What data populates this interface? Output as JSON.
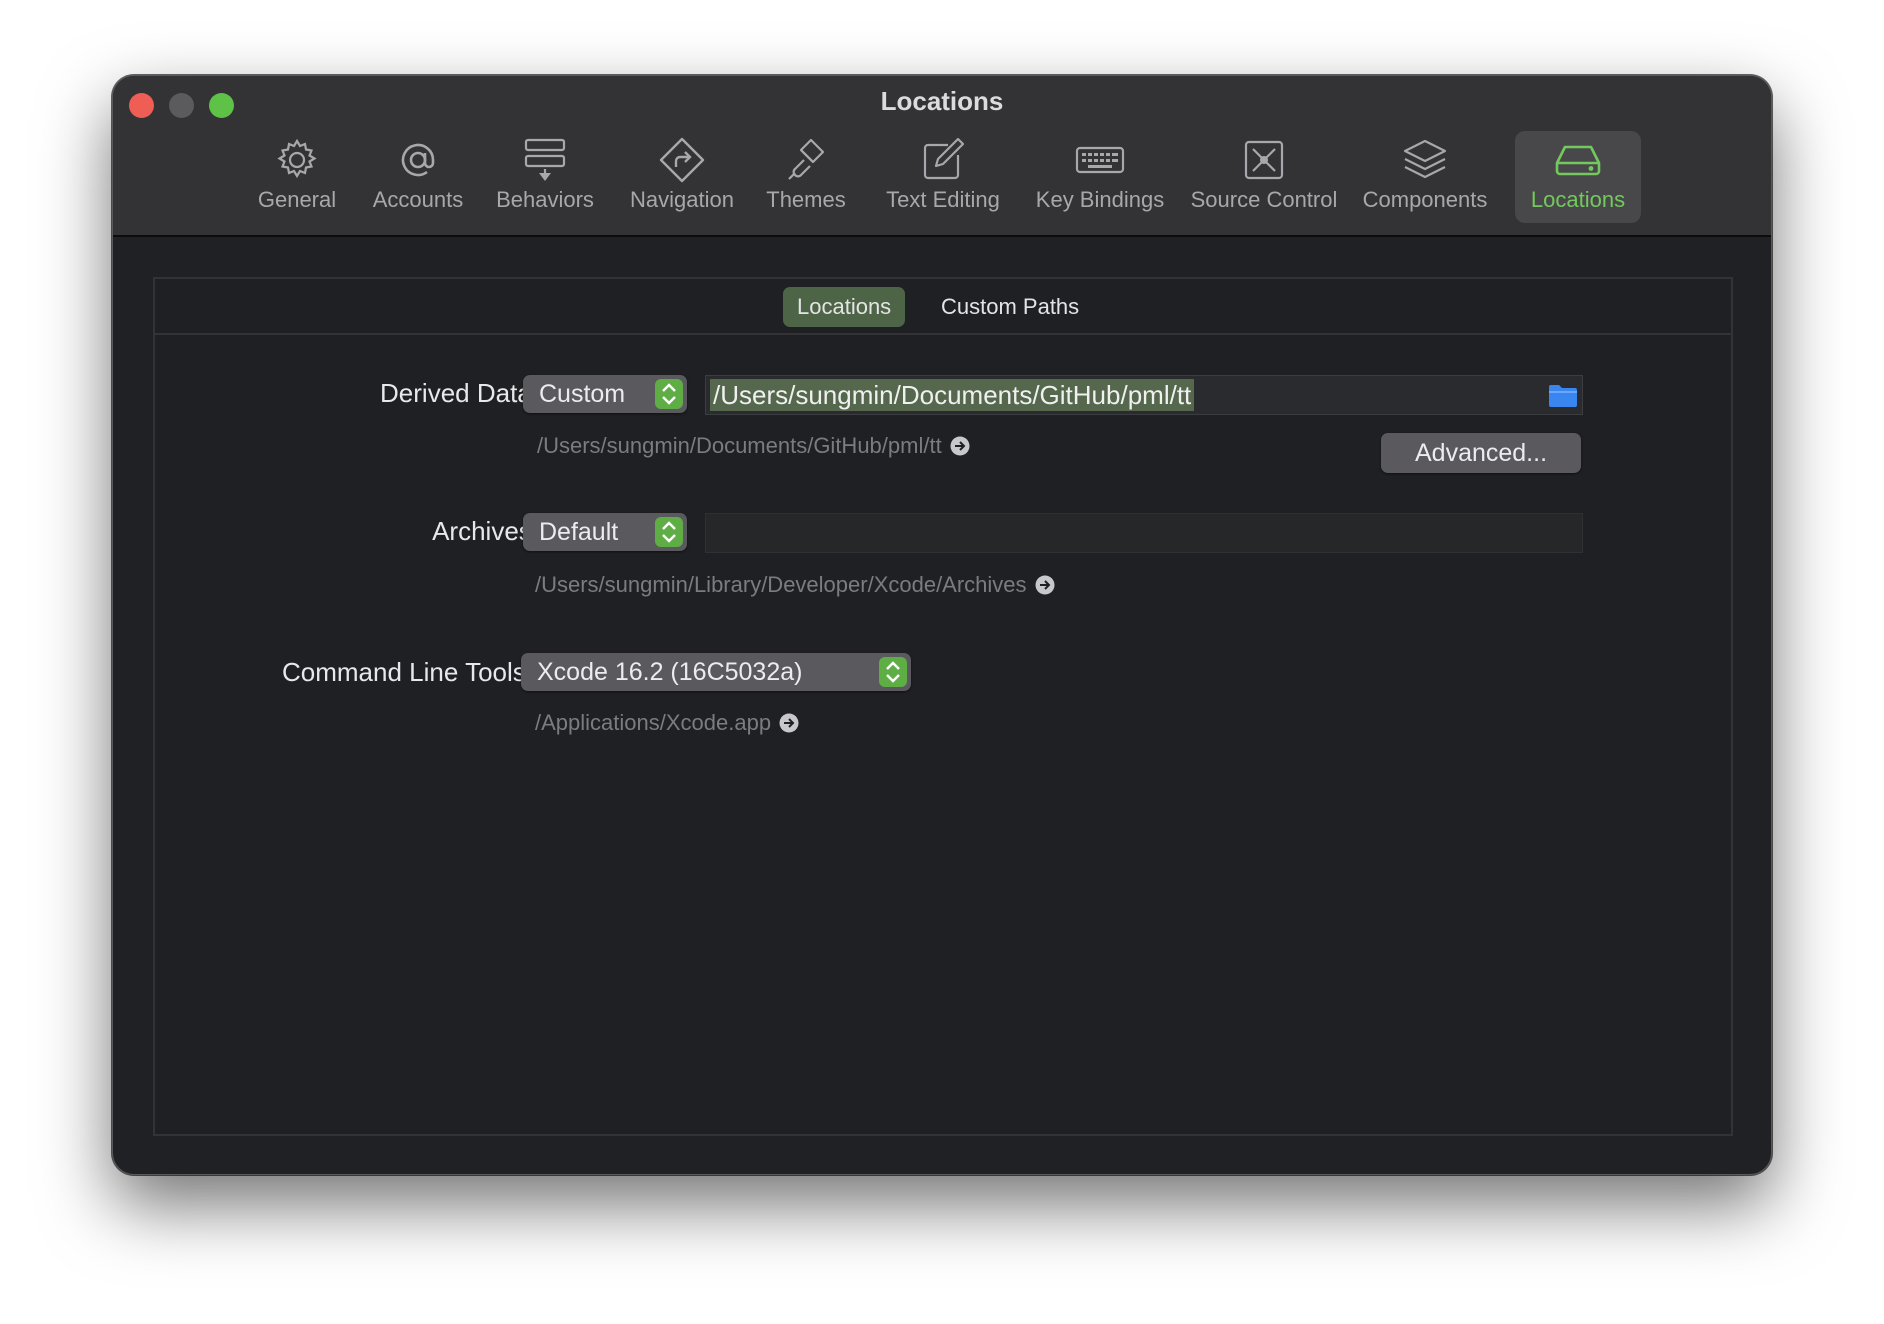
{
  "window": {
    "title": "Locations"
  },
  "toolbar": {
    "items": [
      {
        "label": "General",
        "icon": "gear-icon"
      },
      {
        "label": "Accounts",
        "icon": "at-icon"
      },
      {
        "label": "Behaviors",
        "icon": "behaviors-icon"
      },
      {
        "label": "Navigation",
        "icon": "navigation-icon"
      },
      {
        "label": "Themes",
        "icon": "paintbrush-icon"
      },
      {
        "label": "Text Editing",
        "icon": "pencil-square-icon"
      },
      {
        "label": "Key Bindings",
        "icon": "keyboard-icon"
      },
      {
        "label": "Source Control",
        "icon": "source-control-icon"
      },
      {
        "label": "Components",
        "icon": "stack-icon"
      },
      {
        "label": "Locations",
        "icon": "drive-icon",
        "selected": true
      }
    ],
    "active_color": "#73c95d"
  },
  "tabs": [
    {
      "label": "Locations",
      "selected": true
    },
    {
      "label": "Custom Paths",
      "selected": false
    }
  ],
  "derived_data": {
    "label": "Derived Data:",
    "popup_value": "Custom",
    "path_value": "/Users/sungmin/Documents/GitHub/pml/tt",
    "hint": "/Users/sungmin/Documents/GitHub/pml/tt",
    "advanced_label": "Advanced..."
  },
  "archives": {
    "label": "Archives:",
    "popup_value": "Default",
    "path_value": "",
    "hint": "/Users/sungmin/Library/Developer/Xcode/Archives"
  },
  "command_line_tools": {
    "label": "Command Line Tools:",
    "popup_value": "Xcode 16.2 (16C5032a)",
    "hint": "/Applications/Xcode.app"
  }
}
